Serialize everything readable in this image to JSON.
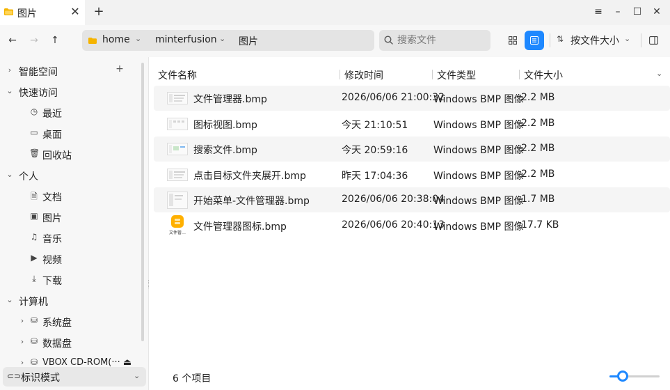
{
  "tab": {
    "title": "图片",
    "close_glyph": "✕",
    "new_glyph": "+"
  },
  "window_buttons": {
    "menu": "≡",
    "minimize": "–",
    "maximize": "☐",
    "close": "✕"
  },
  "nav": {
    "back": "←",
    "forward": "→",
    "up": "↑"
  },
  "breadcrumb": [
    {
      "label": "home"
    },
    {
      "label": "minterfusion"
    },
    {
      "label": "图片"
    }
  ],
  "search": {
    "placeholder": "搜索文件",
    "value": ""
  },
  "sort": {
    "label": "按文件大小"
  },
  "accent_color": "#1e88ff",
  "sidebar": {
    "smart_space": "智能空间",
    "quick_access": "快速访问",
    "recent": "最近",
    "desktop": "桌面",
    "trash": "回收站",
    "personal": "个人",
    "documents": "文档",
    "pictures": "图片",
    "music": "音乐",
    "videos": "视频",
    "downloads": "下载",
    "computer": "计算机",
    "system_disk": "系统盘",
    "data_disk": "数据盘",
    "cdrom": "VBOX CD-ROM(··· ⏏",
    "tag_mode": "标识模式"
  },
  "columns": {
    "name": "文件名称",
    "modified": "修改时间",
    "type": "文件类型",
    "size": "文件大小"
  },
  "files": [
    {
      "name": "文件管理器.bmp",
      "modified": "2026/06/06 21:00:32",
      "type": "Windows BMP 图像",
      "size": "2.2 MB"
    },
    {
      "name": "图标视图.bmp",
      "modified": "今天 21:10:51",
      "type": "Windows BMP 图像",
      "size": "2.2 MB"
    },
    {
      "name": "搜索文件.bmp",
      "modified": "今天 20:59:16",
      "type": "Windows BMP 图像",
      "size": "2.2 MB"
    },
    {
      "name": "点击目标文件夹展开.bmp",
      "modified": "昨天 17:04:36",
      "type": "Windows BMP 图像",
      "size": "2.2 MB"
    },
    {
      "name": "开始菜单-文件管理器.bmp",
      "modified": "2026/06/06 20:38:04",
      "type": "Windows BMP 图像",
      "size": "1.7 MB"
    },
    {
      "name": "文件管理器图标.bmp",
      "modified": "2026/06/06 20:40:13",
      "type": "Windows BMP 图像",
      "size": "17.7 KB"
    }
  ],
  "status": {
    "count": "6 个项目"
  },
  "zoom": {
    "level_fraction": 0.27
  }
}
